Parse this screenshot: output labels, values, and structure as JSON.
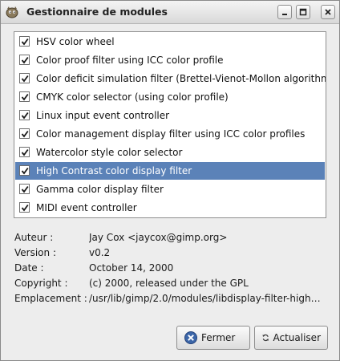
{
  "window": {
    "title": "Gestionnaire de modules"
  },
  "modules": [
    {
      "label": "HSV color wheel",
      "checked": true,
      "selected": false
    },
    {
      "label": "Color proof filter using ICC color profile",
      "checked": true,
      "selected": false
    },
    {
      "label": "Color deficit simulation filter (Brettel-Vienot-Mollon algorithm)",
      "checked": true,
      "selected": false
    },
    {
      "label": "CMYK color selector (using color profile)",
      "checked": true,
      "selected": false
    },
    {
      "label": "Linux input event controller",
      "checked": true,
      "selected": false
    },
    {
      "label": "Color management display filter using ICC color profiles",
      "checked": true,
      "selected": false
    },
    {
      "label": "Watercolor style color selector",
      "checked": true,
      "selected": false
    },
    {
      "label": "High Contrast color display filter",
      "checked": true,
      "selected": true
    },
    {
      "label": "Gamma color display filter",
      "checked": true,
      "selected": false
    },
    {
      "label": "MIDI event controller",
      "checked": true,
      "selected": false
    }
  ],
  "info": {
    "author_label": "Auteur :",
    "author": "Jay Cox <jaycox@gimp.org>",
    "version_label": "Version :",
    "version": "v0.2",
    "date_label": "Date :",
    "date": "October 14, 2000",
    "copyright_label": "Copyright :",
    "copyright": "(c) 2000, released under the GPL",
    "location_label": "Emplacement :",
    "location": "/usr/lib/gimp/2.0/modules/libdisplay-filter-high-…"
  },
  "buttons": {
    "close_label": "Fermer",
    "refresh_label": "Actualiser"
  },
  "colors": {
    "selection": "#5b82b8",
    "window_bg": "#ededed"
  }
}
